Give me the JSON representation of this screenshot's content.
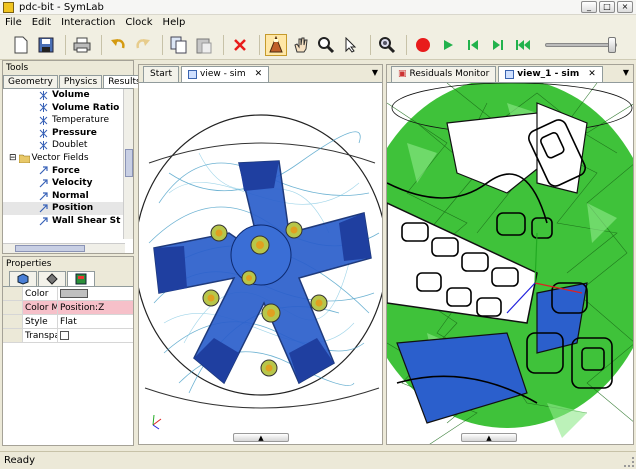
{
  "window": {
    "title": "pdc-bit - SymLab",
    "min": "_",
    "max": "□",
    "close": "×"
  },
  "menu": [
    "File",
    "Edit",
    "Interaction",
    "Clock",
    "Help"
  ],
  "tools": {
    "title": "Tools",
    "tabs": [
      "Geometry",
      "Physics",
      "Results"
    ],
    "active_tab": 2,
    "tree": [
      {
        "label": "Volume",
        "bold": true,
        "indent": 36,
        "icon": "field-icon"
      },
      {
        "label": "Volume Ratio",
        "bold": true,
        "indent": 36,
        "icon": "field-icon"
      },
      {
        "label": "Temperature",
        "bold": false,
        "indent": 36,
        "icon": "field-icon"
      },
      {
        "label": "Pressure",
        "bold": true,
        "indent": 36,
        "icon": "field-icon"
      },
      {
        "label": "Doublet",
        "bold": false,
        "indent": 36,
        "icon": "field-icon"
      },
      {
        "label": "Vector Fields",
        "bold": false,
        "indent": 6,
        "icon": "folder-icon",
        "expander": "⊟"
      },
      {
        "label": "Force",
        "bold": true,
        "indent": 36,
        "icon": "vector-icon"
      },
      {
        "label": "Velocity",
        "bold": true,
        "indent": 36,
        "icon": "vector-icon"
      },
      {
        "label": "Normal",
        "bold": true,
        "indent": 36,
        "icon": "vector-icon"
      },
      {
        "label": "Position",
        "bold": true,
        "indent": 36,
        "icon": "vector-icon",
        "selected": true
      },
      {
        "label": "Wall Shear St",
        "bold": true,
        "indent": 36,
        "icon": "vector-icon"
      }
    ]
  },
  "properties": {
    "title": "Properties",
    "tab_icons": [
      "cube-icon",
      "diamond-icon",
      "palette-icon"
    ],
    "rows": [
      {
        "name": "Color",
        "value": "",
        "type": "swatch",
        "swatch_color": "#bfbfbf"
      },
      {
        "name": "Color Ma",
        "value": "Position:Z",
        "type": "text",
        "highlight": true
      },
      {
        "name": "Style",
        "value": "Flat",
        "type": "text"
      },
      {
        "name": "Transpar",
        "value": "",
        "type": "checkbox"
      }
    ]
  },
  "view_left": {
    "tabs": [
      {
        "label": "Start"
      },
      {
        "label": "view - sim",
        "closable": true,
        "active": true
      }
    ]
  },
  "view_right": {
    "tabs": [
      {
        "label": "Residuals Monitor"
      },
      {
        "label": "view_1 - sim",
        "closable": true,
        "active": true
      }
    ]
  },
  "status": {
    "text": "Ready"
  },
  "colors": {
    "accent": "#e81b1b",
    "play": "#22b24c",
    "mesh_green": "#3fc23a",
    "bit_blue": "#2b5fcc"
  }
}
